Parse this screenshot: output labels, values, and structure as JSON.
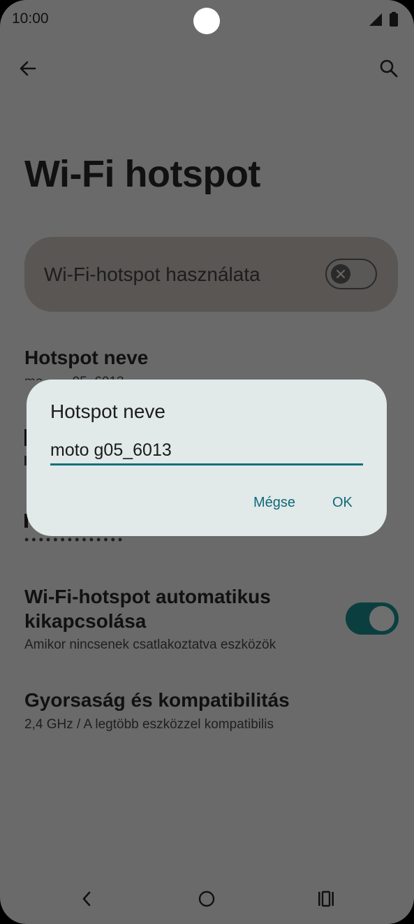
{
  "status_bar": {
    "time": "10:00",
    "signal_icon": "cellular-signal-icon",
    "battery_icon": "battery-icon"
  },
  "app_bar": {
    "back_icon": "arrow-back-icon",
    "search_icon": "search-icon"
  },
  "page": {
    "title": "Wi-Fi hotspot"
  },
  "main_toggle": {
    "label": "Wi-Fi-hotspot használata",
    "state": "off"
  },
  "settings": {
    "hotspot_name": {
      "title": "Hotspot neve",
      "value_partial": "mo        05_6013"
    },
    "password": {
      "masked_value": "••••••••••••••"
    },
    "auto_off": {
      "title_line1": "Wi-Fi-hotspot automatikus",
      "title_line2": "kikapcsolása",
      "subtitle": "Amikor nincsenek csatlakoztatva eszközök",
      "state": "on"
    },
    "speed": {
      "title": "Gyorsaság és kompatibilitás",
      "subtitle": "2,4 GHz / A legtöbb eszközzel kompatibilis"
    }
  },
  "dialog": {
    "title": "Hotspot neve",
    "input_value": "moto g05_6013",
    "cancel_label": "Mégse",
    "ok_label": "OK"
  },
  "nav_bar": {
    "back_icon": "nav-back-icon",
    "home_icon": "nav-home-icon",
    "recents_icon": "nav-recents-icon"
  },
  "colors": {
    "scrim_background": "#6a6a6a",
    "dialog_background": "#e1e9e9",
    "accent": "#0f6a75",
    "switch_on_track": "#0b3f3f"
  }
}
